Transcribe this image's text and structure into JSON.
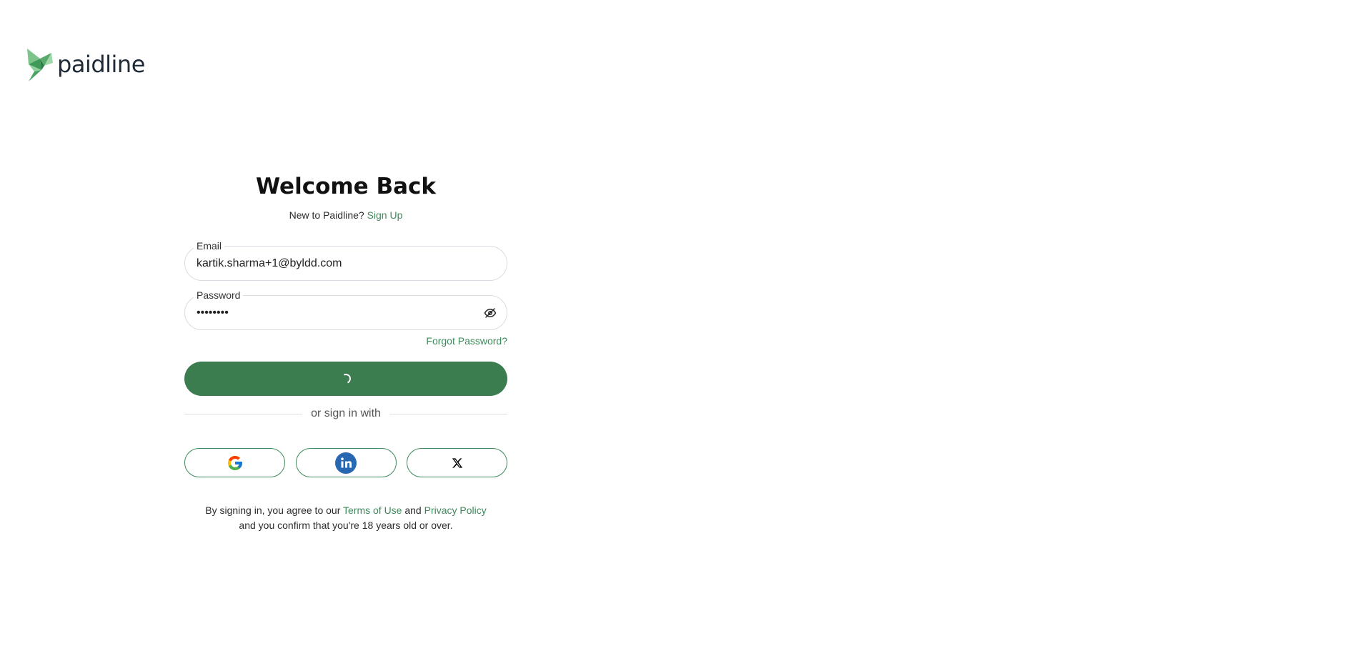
{
  "brand": {
    "name": "paidline",
    "color": "#5aaa6b"
  },
  "login": {
    "title": "Welcome Back",
    "new_prompt": "New to Paidline?",
    "signup_link": "Sign Up",
    "email": {
      "label": "Email",
      "value": "kartik.sharma+1@byldd.com"
    },
    "password": {
      "label": "Password",
      "value": "••••••••",
      "toggle_icon": "eye-off-icon"
    },
    "forgot_link": "Forgot Password?",
    "submit": {
      "state": "loading",
      "icon": "spinner-icon",
      "color": "#3b7d4f"
    },
    "divider_text": "or sign in with",
    "social": [
      {
        "provider": "Google",
        "icon": "google-icon"
      },
      {
        "provider": "LinkedIn",
        "icon": "linkedin-icon",
        "color": "#2867b2"
      },
      {
        "provider": "X",
        "icon": "x-icon"
      }
    ],
    "terms": {
      "prefix": "By signing in, you agree to our",
      "terms_link": "Terms of Use",
      "and": "and",
      "privacy_link": "Privacy Policy",
      "suffix": "and you confirm that you're 18 years old or over."
    }
  },
  "colors": {
    "accent": "#3d8a5a",
    "button": "#3b7d4f"
  }
}
